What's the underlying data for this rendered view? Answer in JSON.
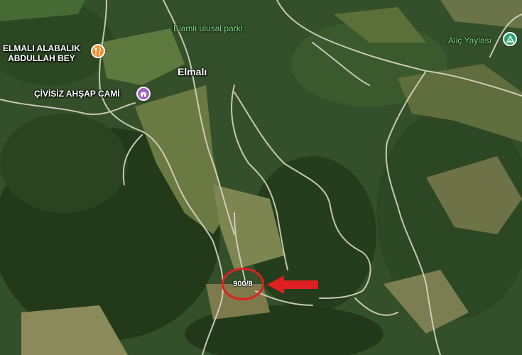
{
  "places": {
    "park": "Elamlı ulusal parkı",
    "restaurant": "ELMALI ALABALIK\nABDULLAH BEY",
    "mosque": "ÇİVİSİZ AHŞAP CAMİ",
    "village": "Elmalı",
    "plateau": "Aliç Yaylası"
  },
  "parcel": {
    "label": "900/8"
  },
  "icons": {
    "restaurant": "fork-knife-icon",
    "mosque": "mosque-icon",
    "plateau": "campground-icon",
    "arrow": "red-arrow-icon"
  },
  "colors": {
    "highlight": "#e02020",
    "restaurant_pin": "#f08d2d",
    "mosque_pin": "#9c65c9",
    "camp_pin": "#27a36b",
    "park_label": "#7ee08a"
  }
}
